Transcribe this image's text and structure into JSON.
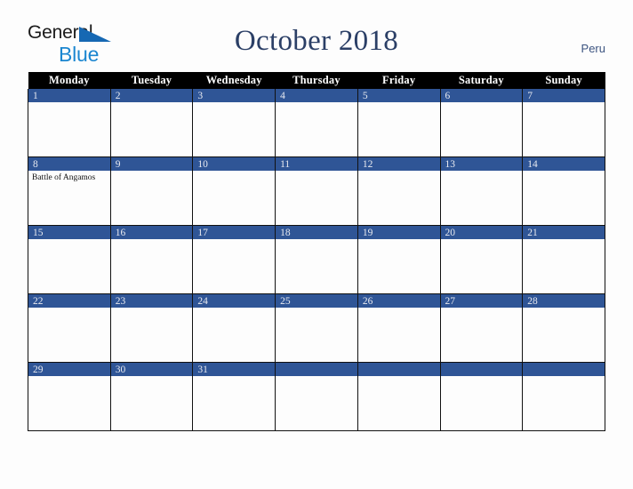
{
  "brand": {
    "word1": "General",
    "word2": "Blue",
    "triangle_icon": "triangle-icon",
    "color_dark": "#1a1a1a",
    "color_blue": "#1b86d0"
  },
  "header": {
    "title": "October 2018",
    "country": "Peru",
    "title_color": "#2b3f66"
  },
  "calendar": {
    "weekday_headers": [
      "Monday",
      "Tuesday",
      "Wednesday",
      "Thursday",
      "Friday",
      "Saturday",
      "Sunday"
    ],
    "header_bg": "#000000",
    "daynum_bg": "#2f5596",
    "daynum_color": "#e8eaf0",
    "weeks": [
      [
        {
          "day": "1",
          "events": []
        },
        {
          "day": "2",
          "events": []
        },
        {
          "day": "3",
          "events": []
        },
        {
          "day": "4",
          "events": []
        },
        {
          "day": "5",
          "events": []
        },
        {
          "day": "6",
          "events": []
        },
        {
          "day": "7",
          "events": []
        }
      ],
      [
        {
          "day": "8",
          "events": [
            "Battle of Angamos"
          ]
        },
        {
          "day": "9",
          "events": []
        },
        {
          "day": "10",
          "events": []
        },
        {
          "day": "11",
          "events": []
        },
        {
          "day": "12",
          "events": []
        },
        {
          "day": "13",
          "events": []
        },
        {
          "day": "14",
          "events": []
        }
      ],
      [
        {
          "day": "15",
          "events": []
        },
        {
          "day": "16",
          "events": []
        },
        {
          "day": "17",
          "events": []
        },
        {
          "day": "18",
          "events": []
        },
        {
          "day": "19",
          "events": []
        },
        {
          "day": "20",
          "events": []
        },
        {
          "day": "21",
          "events": []
        }
      ],
      [
        {
          "day": "22",
          "events": []
        },
        {
          "day": "23",
          "events": []
        },
        {
          "day": "24",
          "events": []
        },
        {
          "day": "25",
          "events": []
        },
        {
          "day": "26",
          "events": []
        },
        {
          "day": "27",
          "events": []
        },
        {
          "day": "28",
          "events": []
        }
      ],
      [
        {
          "day": "29",
          "events": []
        },
        {
          "day": "30",
          "events": []
        },
        {
          "day": "31",
          "events": []
        },
        {
          "day": "",
          "events": []
        },
        {
          "day": "",
          "events": []
        },
        {
          "day": "",
          "events": []
        },
        {
          "day": "",
          "events": []
        }
      ]
    ]
  }
}
